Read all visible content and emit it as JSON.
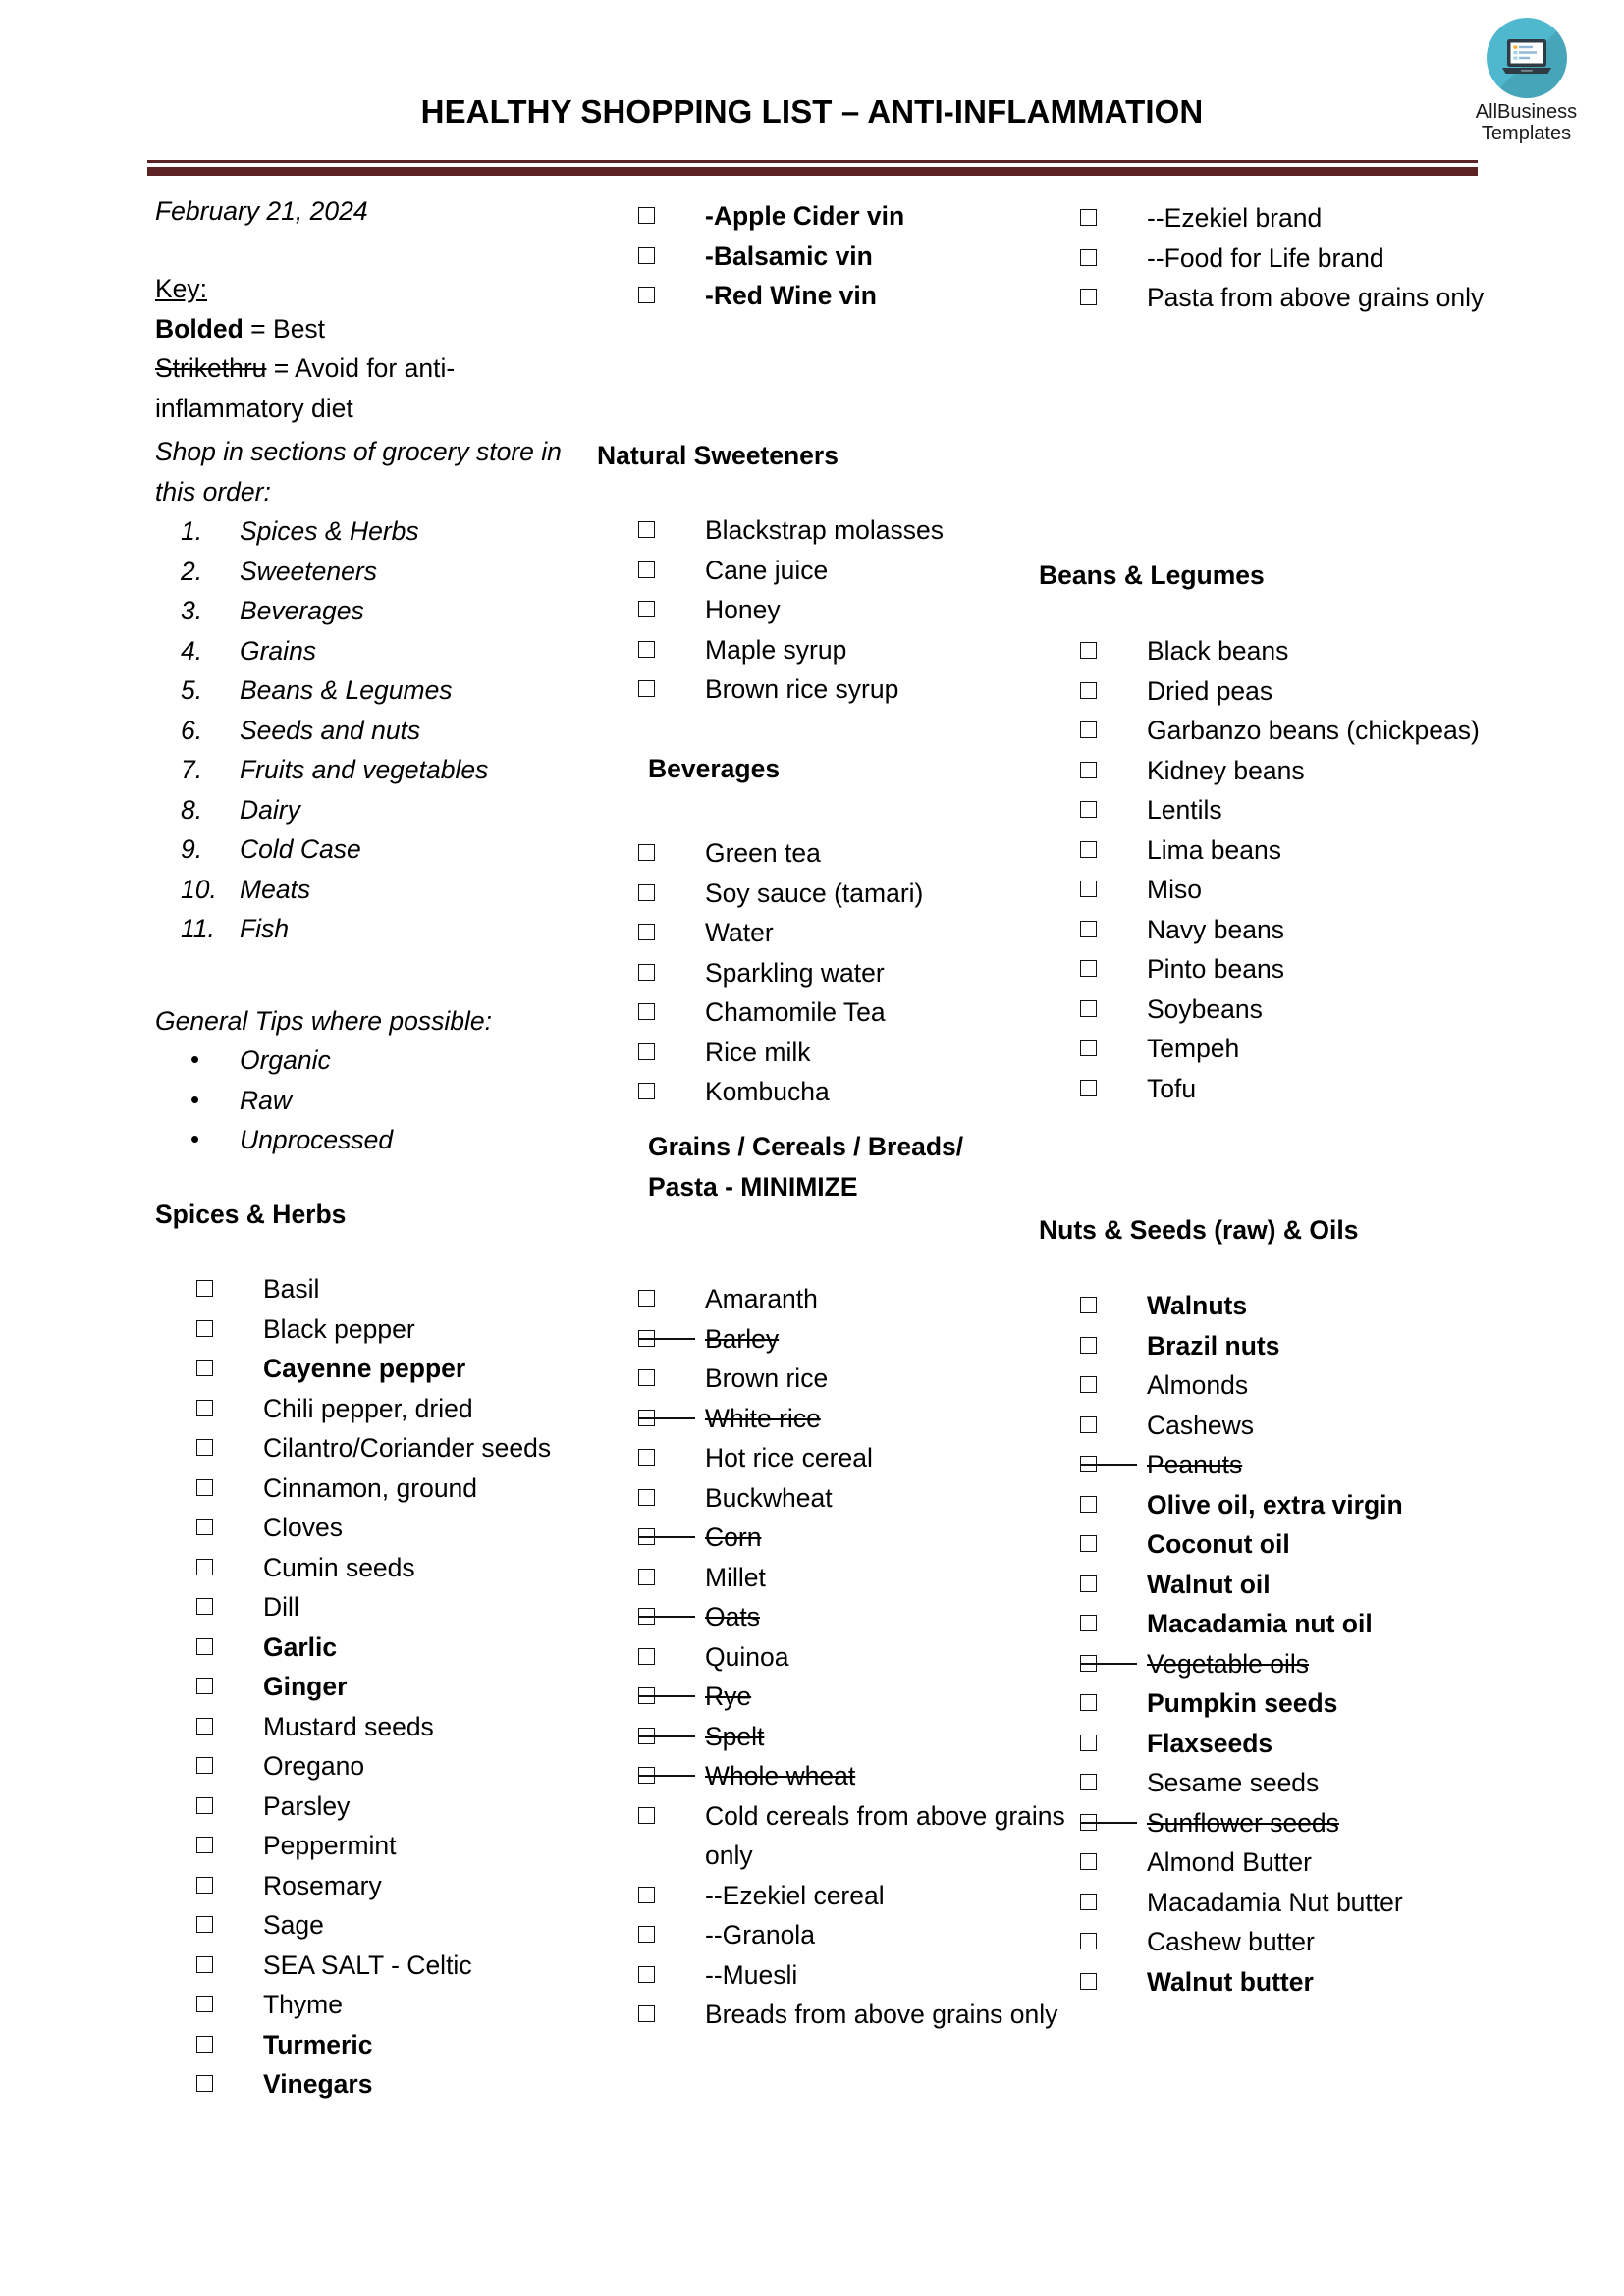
{
  "header": {
    "title": "HEALTHY SHOPPING LIST – ANTI-INFLAMMATION",
    "rule_color": "#5B2223"
  },
  "logo": {
    "icon": "laptop-icon",
    "circle_color": "#4FB8CE",
    "line1": "AllBusiness",
    "line2": "Templates"
  },
  "left_column": {
    "date": "February 21, 2024",
    "key_heading": "Key:",
    "key_bolded_term": "Bolded",
    "key_bolded_def": " = Best",
    "key_strike_term": "Strikethru",
    "key_strike_def": " = Avoid for anti-inflammatory diet",
    "shop_order_intro": "Shop in sections of grocery store in this order:",
    "shop_order": [
      {
        "num": "1.",
        "label": "Spices & Herbs"
      },
      {
        "num": "2.",
        "label": "Sweeteners"
      },
      {
        "num": "3.",
        "label": "Beverages"
      },
      {
        "num": "4.",
        "label": "Grains"
      },
      {
        "num": "5.",
        "label": "Beans & Legumes"
      },
      {
        "num": "6.",
        "label": "Seeds and nuts"
      },
      {
        "num": "7.",
        "label": "Fruits and vegetables"
      },
      {
        "num": "8.",
        "label": "Dairy"
      },
      {
        "num": "9.",
        "label": "Cold Case"
      },
      {
        "num": "10.",
        "label": "Meats"
      },
      {
        "num": "11.",
        "label": "Fish"
      }
    ],
    "tips_heading": "General Tips where possible:",
    "tips": [
      "Organic",
      "Raw",
      "Unprocessed"
    ],
    "spices_heading": "Spices & Herbs",
    "spices": [
      {
        "label": "Basil",
        "bold": false,
        "strike": false
      },
      {
        "label": "Black pepper",
        "bold": false,
        "strike": false
      },
      {
        "label": "Cayenne pepper",
        "bold": true,
        "strike": false
      },
      {
        "label": "Chili pepper, dried",
        "bold": false,
        "strike": false
      },
      {
        "label": "Cilantro/Coriander seeds",
        "bold": false,
        "strike": false
      },
      {
        "label": "Cinnamon, ground",
        "bold": false,
        "strike": false
      },
      {
        "label": "Cloves",
        "bold": false,
        "strike": false
      },
      {
        "label": "Cumin seeds",
        "bold": false,
        "strike": false
      },
      {
        "label": "Dill",
        "bold": false,
        "strike": false
      },
      {
        "label": "Garlic",
        "bold": true,
        "strike": false
      },
      {
        "label": "Ginger",
        "bold": true,
        "strike": false
      },
      {
        "label": "Mustard seeds",
        "bold": false,
        "strike": false
      },
      {
        "label": "Oregano",
        "bold": false,
        "strike": false
      },
      {
        "label": "Parsley",
        "bold": false,
        "strike": false
      },
      {
        "label": "Peppermint",
        "bold": false,
        "strike": false
      },
      {
        "label": "Rosemary",
        "bold": false,
        "strike": false
      },
      {
        "label": "Sage",
        "bold": false,
        "strike": false
      },
      {
        "label": "SEA SALT - Celtic",
        "bold": false,
        "strike": false
      },
      {
        "label": "Thyme",
        "bold": false,
        "strike": false
      },
      {
        "label": "Turmeric",
        "bold": true,
        "strike": false
      },
      {
        "label": "Vinegars",
        "bold": true,
        "strike": false
      }
    ]
  },
  "middle_column": {
    "vinegars": [
      {
        "label": "-Apple Cider vin",
        "bold": true,
        "strike": false
      },
      {
        "label": "-Balsamic vin",
        "bold": true,
        "strike": false
      },
      {
        "label": "-Red Wine vin",
        "bold": true,
        "strike": false
      }
    ],
    "sweeteners_heading": "Natural Sweeteners",
    "sweeteners": [
      {
        "label": "Blackstrap molasses",
        "bold": false,
        "strike": false
      },
      {
        "label": "Cane juice",
        "bold": false,
        "strike": false
      },
      {
        "label": "Honey",
        "bold": false,
        "strike": false
      },
      {
        "label": "Maple syrup",
        "bold": false,
        "strike": false
      },
      {
        "label": "Brown rice syrup",
        "bold": false,
        "strike": false
      }
    ],
    "beverages_heading": "Beverages",
    "beverages": [
      {
        "label": "Green tea",
        "bold": false,
        "strike": false
      },
      {
        "label": "Soy sauce (tamari)",
        "bold": false,
        "strike": false
      },
      {
        "label": "Water",
        "bold": false,
        "strike": false
      },
      {
        "label": "Sparkling water",
        "bold": false,
        "strike": false
      },
      {
        "label": "Chamomile Tea",
        "bold": false,
        "strike": false
      },
      {
        "label": "Rice milk",
        "bold": false,
        "strike": false
      },
      {
        "label": "Kombucha",
        "bold": false,
        "strike": false
      }
    ],
    "grains_heading": "Grains / Cereals / Breads/ Pasta - MINIMIZE",
    "grains": [
      {
        "label": "Amaranth",
        "bold": false,
        "strike": false
      },
      {
        "label": "Barley",
        "bold": false,
        "strike": true
      },
      {
        "label": "Brown rice",
        "bold": false,
        "strike": false
      },
      {
        "label": "White rice",
        "bold": false,
        "strike": true
      },
      {
        "label": "Hot rice cereal",
        "bold": false,
        "strike": false
      },
      {
        "label": "Buckwheat",
        "bold": false,
        "strike": false
      },
      {
        "label": "Corn",
        "bold": false,
        "strike": true
      },
      {
        "label": "Millet",
        "bold": false,
        "strike": false
      },
      {
        "label": "Oats",
        "bold": false,
        "strike": true
      },
      {
        "label": "Quinoa",
        "bold": false,
        "strike": false
      },
      {
        "label": "Rye",
        "bold": false,
        "strike": true
      },
      {
        "label": "Spelt",
        "bold": false,
        "strike": true
      },
      {
        "label": "Whole wheat",
        "bold": false,
        "strike": true
      },
      {
        "label": "Cold cereals from above grains only",
        "bold": false,
        "strike": false
      },
      {
        "label": "--Ezekiel cereal",
        "bold": false,
        "strike": false
      },
      {
        "label": "--Granola",
        "bold": false,
        "strike": false
      },
      {
        "label": "--Muesli",
        "bold": false,
        "strike": false
      },
      {
        "label": "Breads from above grains only",
        "bold": false,
        "strike": false
      }
    ]
  },
  "right_column": {
    "breads_continued": [
      {
        "label": "--Ezekiel brand",
        "bold": false,
        "strike": false
      },
      {
        "label": "--Food for Life brand",
        "bold": false,
        "strike": false
      },
      {
        "label": "Pasta from above grains only",
        "bold": false,
        "strike": false
      }
    ],
    "beans_heading": "Beans & Legumes",
    "beans": [
      {
        "label": "Black beans",
        "bold": false,
        "strike": false
      },
      {
        "label": "Dried peas",
        "bold": false,
        "strike": false
      },
      {
        "label": "Garbanzo beans (chickpeas)",
        "bold": false,
        "strike": false
      },
      {
        "label": "Kidney beans",
        "bold": false,
        "strike": false
      },
      {
        "label": "Lentils",
        "bold": false,
        "strike": false
      },
      {
        "label": "Lima beans",
        "bold": false,
        "strike": false
      },
      {
        "label": "Miso",
        "bold": false,
        "strike": false
      },
      {
        "label": "Navy beans",
        "bold": false,
        "strike": false
      },
      {
        "label": "Pinto beans",
        "bold": false,
        "strike": false
      },
      {
        "label": "Soybeans",
        "bold": false,
        "strike": false
      },
      {
        "label": "Tempeh",
        "bold": false,
        "strike": false
      },
      {
        "label": "Tofu",
        "bold": false,
        "strike": false
      }
    ],
    "nuts_heading": "Nuts & Seeds (raw) & Oils",
    "nuts": [
      {
        "label": "Walnuts",
        "bold": true,
        "strike": false
      },
      {
        "label": "Brazil nuts",
        "bold": true,
        "strike": false
      },
      {
        "label": "Almonds",
        "bold": false,
        "strike": false
      },
      {
        "label": "Cashews",
        "bold": false,
        "strike": false
      },
      {
        "label": "Peanuts",
        "bold": false,
        "strike": true
      },
      {
        "label": "Olive oil, extra virgin",
        "bold": true,
        "strike": false
      },
      {
        "label": "Coconut oil",
        "bold": true,
        "strike": false
      },
      {
        "label": "Walnut oil",
        "bold": true,
        "strike": false
      },
      {
        "label": "Macadamia nut oil",
        "bold": true,
        "strike": false
      },
      {
        "label": "Vegetable oils",
        "bold": false,
        "strike": true
      },
      {
        "label": "Pumpkin seeds",
        "bold": true,
        "strike": false
      },
      {
        "label": "Flaxseeds",
        "bold": true,
        "strike": false
      },
      {
        "label": "Sesame seeds",
        "bold": false,
        "strike": false
      },
      {
        "label": "Sunflower seeds",
        "bold": false,
        "strike": true
      },
      {
        "label": "Almond Butter",
        "bold": false,
        "strike": false
      },
      {
        "label": "Macadamia Nut butter",
        "bold": false,
        "strike": false
      },
      {
        "label": "Cashew butter",
        "bold": false,
        "strike": false
      },
      {
        "label": "Walnut butter",
        "bold": true,
        "strike": false
      }
    ]
  }
}
